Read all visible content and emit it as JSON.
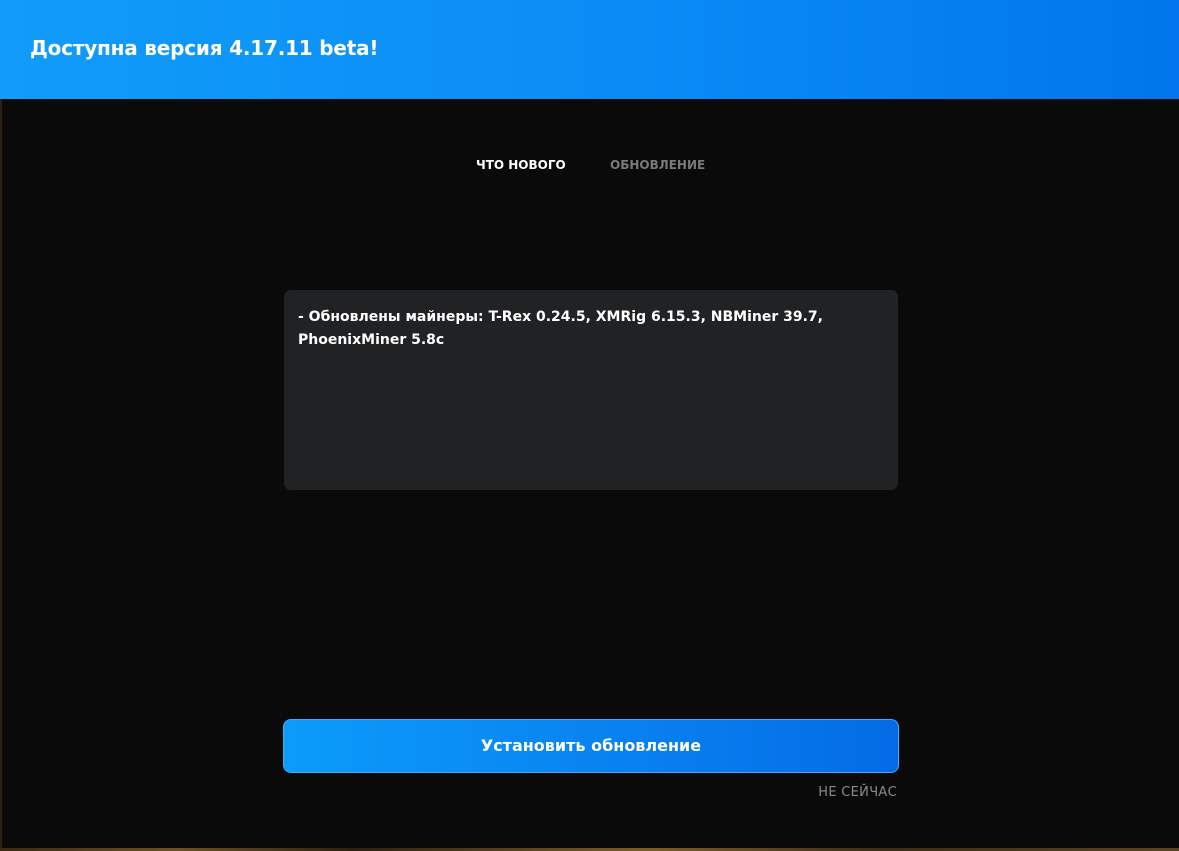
{
  "header": {
    "title": "Доступна версия 4.17.11 beta!",
    "color_start": "#119cf9",
    "color_end": "#0176ec"
  },
  "tabs": [
    {
      "label": "ЧТО НОВОГО",
      "active": true
    },
    {
      "label": "ОБНОВЛЕНИЕ",
      "active": false
    }
  ],
  "release_notes": {
    "text": "- Обновлены майнеры: T-Rex 0.24.5, XMRig 6.15.3, NBMiner 39.7, PhoenixMiner 5.8c"
  },
  "actions": {
    "install_label": "Установить обновление",
    "later_label": "НЕ СЕЙЧАС"
  },
  "colors": {
    "background": "#0a0a0a",
    "panel": "#212224",
    "accent": "#0a8bf6",
    "muted_text": "#7a7a7a"
  }
}
